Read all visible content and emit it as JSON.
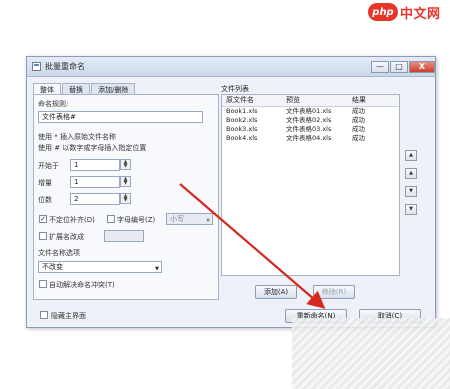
{
  "watermark": {
    "logo": "php",
    "text": "中文网"
  },
  "window": {
    "title": "批量重命名",
    "controls": [
      "—",
      "□",
      "X"
    ]
  },
  "tabs": [
    "整体",
    "替换",
    "添加/删除"
  ],
  "left": {
    "naming_rule_label": "命名规则:",
    "naming_rule_value": "文件表格#",
    "help_line1": "使用 * 插入原始文件名称",
    "help_line2": "使用 # 以数字或字母插入指定位置",
    "start_label": "开始于",
    "start_value": "1",
    "increment_label": "增量",
    "increment_value": "1",
    "digits_label": "位数",
    "digits_value": "2",
    "unfixed_digits_label": "不定位补齐(D)",
    "unfixed_digits_checked": true,
    "letter_number_label": "字母编号(Z)",
    "letter_number_checked": false,
    "case_value": "小写",
    "extension_label": "扩展名改成",
    "extension_checked": false,
    "filename_case_label": "文件名称选项",
    "filename_case_value": "不改变",
    "auto_resolve_label": "自动解决命名冲突(T)",
    "auto_resolve_checked": false
  },
  "file_list": {
    "label": "文件列表",
    "headers": [
      "原文件名",
      "预览",
      "结果"
    ],
    "rows": [
      [
        "Book1.xls",
        "文件表格01.xls",
        "成功"
      ],
      [
        "Book2.xls",
        "文件表格02.xls",
        "成功"
      ],
      [
        "Book3.xls",
        "文件表格03.xls",
        "成功"
      ],
      [
        "Book4.xls",
        "文件表格04.xls",
        "成功"
      ]
    ]
  },
  "side_buttons": [
    "▲",
    "▲",
    "▼",
    "▼"
  ],
  "buttons": {
    "add": "添加(A)",
    "remove": "移除(R)",
    "rename": "重新命名(N)",
    "cancel": "取消(C)"
  },
  "hide_main_label": "隐藏主界面",
  "hide_main_checked": false
}
